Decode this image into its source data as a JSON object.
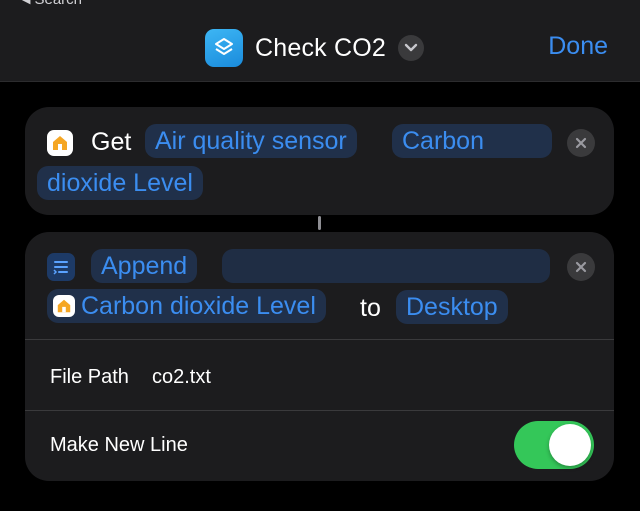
{
  "nav": {
    "back_label": "Search",
    "title": "Check CO2",
    "done_label": "Done"
  },
  "colors": {
    "accent": "#3b8df0",
    "toggle_on": "#34c759",
    "app_icon": "#1a8bdc"
  },
  "action_get": {
    "verb": "Get",
    "device": "Air quality sensor",
    "characteristic_line1": "Carbon",
    "characteristic_line2": "dioxide Level",
    "icon": "home-icon"
  },
  "action_append": {
    "verb": "Append",
    "variable": "Carbon dioxide Level",
    "connector": "to",
    "destination": "Desktop",
    "icon": "text-list-icon",
    "file_path_label": "File Path",
    "file_path_value": "co2.txt",
    "new_line_label": "Make New Line",
    "new_line_enabled": true
  }
}
